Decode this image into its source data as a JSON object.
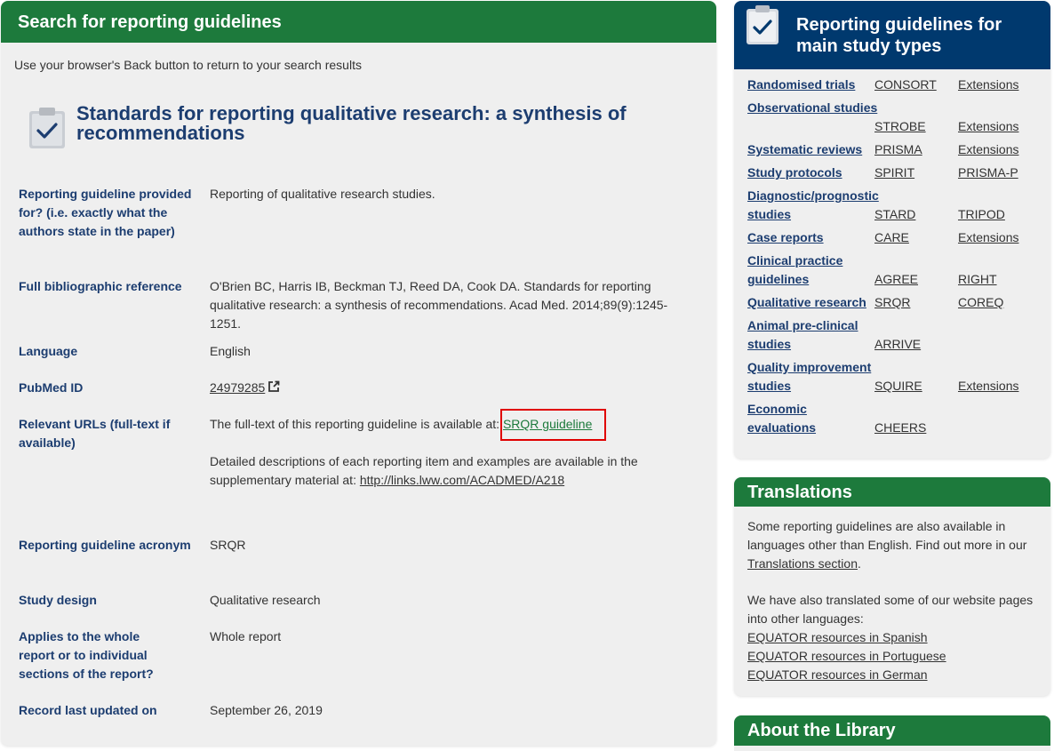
{
  "main": {
    "header": "Search for reporting guidelines",
    "back_note": "Use your browser's Back button to return to your search results",
    "title": "Standards for reporting qualitative research: a synthesis of recommendations",
    "fields": {
      "provided_for_label": "Reporting guideline provided for? (i.e. exactly what the authors state in the paper)",
      "provided_for_value": "Reporting of qualitative research studies.",
      "biblio_label": "Full bibliographic reference",
      "biblio_value": "O'Brien BC, Harris IB, Beckman TJ, Reed DA, Cook DA. Standards for reporting qualitative research: a synthesis of recommendations. Acad Med. 2014;89(9):1245-1251.",
      "language_label": "Language",
      "language_value": "English",
      "pubmed_label": "PubMed ID",
      "pubmed_value": "24979285",
      "urls_label": "Relevant URLs (full-text if available)",
      "urls_text1": "The full-text of this reporting guideline is available at: ",
      "urls_link1": "SRQR guideline",
      "urls_text2": "Detailed descriptions of each reporting item and examples are available in the supplementary material at: ",
      "urls_link2": "http://links.lww.com/ACADMED/A218",
      "acronym_label": "Reporting guideline acronym",
      "acronym_value": "SRQR",
      "design_label": "Study design",
      "design_value": "Qualitative research",
      "applies_label": "Applies to the whole report or to individual sections of the report?",
      "applies_value": "Whole report",
      "updated_label": "Record last updated on",
      "updated_value": "September 26, 2019"
    }
  },
  "sidebar": {
    "guidelines_title": "Reporting guidelines for main study types",
    "rows": [
      {
        "name": "Randomised trials",
        "a": "CONSORT",
        "b": "Extensions"
      },
      {
        "name": "Observational studies",
        "a": "STROBE",
        "b": "Extensions"
      },
      {
        "name": "Systematic reviews",
        "a": "PRISMA",
        "b": "Extensions"
      },
      {
        "name": "Study protocols",
        "a": "SPIRIT",
        "b": "PRISMA-P"
      },
      {
        "name": "Diagnostic/prognostic studies",
        "a": "STARD",
        "b": "TRIPOD"
      },
      {
        "name": "Case reports",
        "a": "CARE",
        "b": "Extensions"
      },
      {
        "name": "Clinical practice guidelines",
        "a": "AGREE",
        "b": "RIGHT"
      },
      {
        "name": "Qualitative research",
        "a": "SRQR",
        "b": "COREQ"
      },
      {
        "name": "Animal pre-clinical studies",
        "a": "ARRIVE",
        "b": ""
      },
      {
        "name": "Quality improvement studies",
        "a": "SQUIRE",
        "b": "Extensions"
      },
      {
        "name": "Economic evaluations",
        "a": "CHEERS",
        "b": ""
      }
    ],
    "translations_title": "Translations",
    "translations_p1_text": "Some reporting guidelines are also available in languages other than English. Find out more in our ",
    "translations_p1_link": "Translations section",
    "translations_p1_end": ".",
    "translations_p2_text": "We have also translated some of our website pages into other languages:",
    "translations_links": [
      "EQUATOR resources in Spanish",
      "EQUATOR resources in Portuguese",
      "EQUATOR resources in German"
    ],
    "about_title": "About the Library"
  },
  "colors": {
    "green": "#1d7a3c",
    "navy": "#00396e",
    "highlight": "#e00000"
  },
  "icons": {
    "title": "clipboard-check-icon",
    "external": "external-link-icon"
  }
}
